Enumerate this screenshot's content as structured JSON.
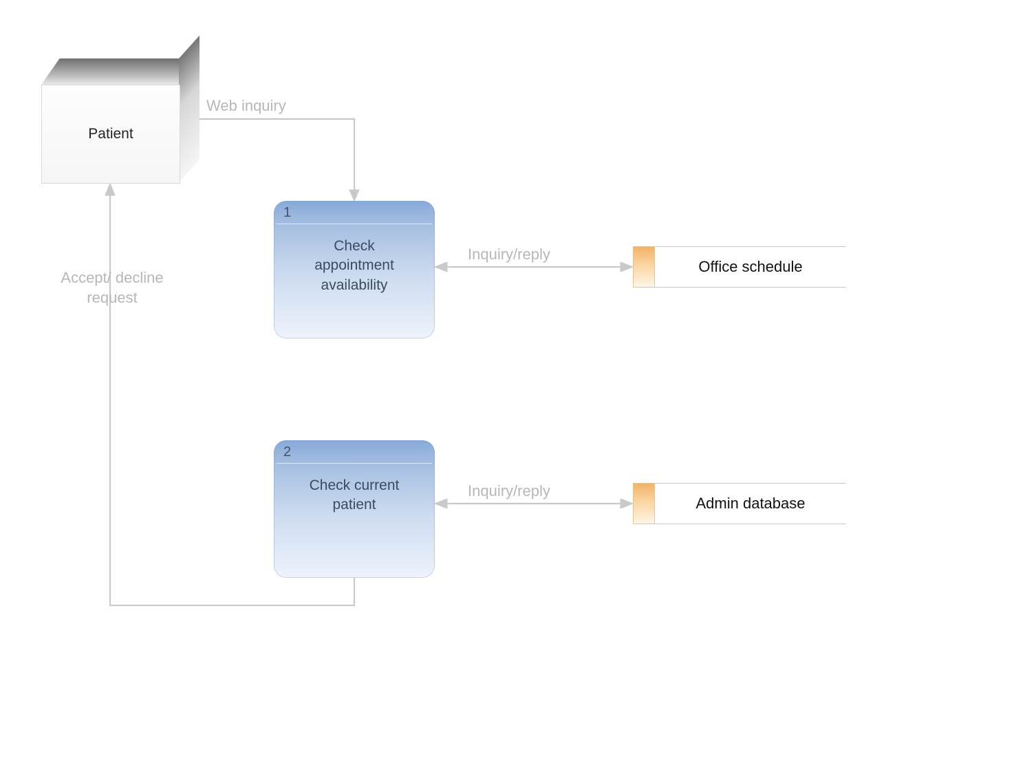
{
  "entity": {
    "label": "Patient"
  },
  "processes": [
    {
      "num": "1",
      "label": "Check\nappointment\navailability"
    },
    {
      "num": "2",
      "label": "Check current\npatient"
    }
  ],
  "datastores": [
    {
      "label": "Office schedule"
    },
    {
      "label": "Admin database"
    }
  ],
  "edges": {
    "web_inquiry": "Web inquiry",
    "accept_decline": "Accept/ decline request",
    "inquiry_reply_1": "Inquiry/reply",
    "inquiry_reply_2": "Inquiry/reply"
  }
}
